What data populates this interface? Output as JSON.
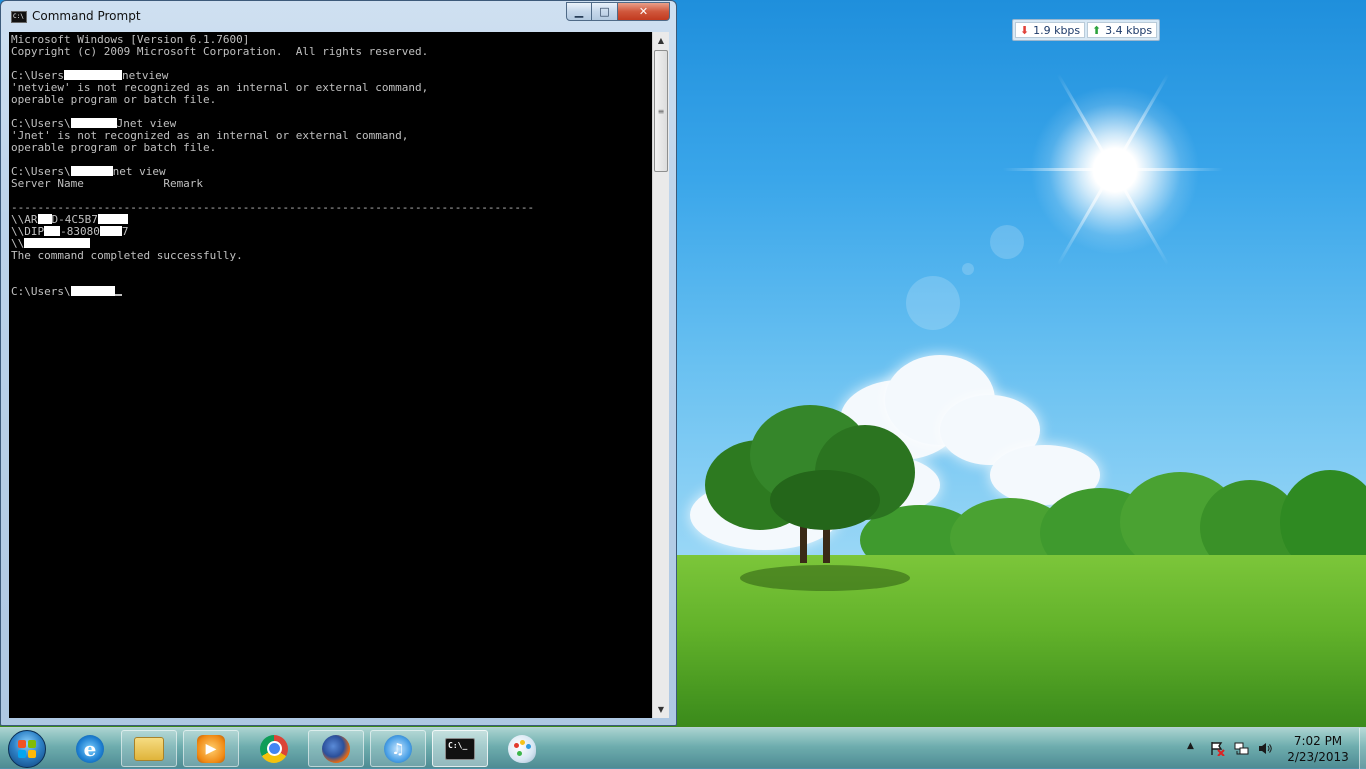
{
  "window": {
    "title": "Command Prompt",
    "icon_label": "C:\\",
    "minimize_symbol": "▁",
    "maximize_symbol": "□",
    "close_symbol": "✕"
  },
  "console": {
    "lines": [
      "Microsoft Windows [Version 6.1.7600]",
      "Copyright (c) 2009 Microsoft Corporation.  All rights reserved.",
      "",
      "C:\\Users",
      "'netview' is not recognized as an internal or external command,",
      "operable program or batch file.",
      "",
      "C:\\Users\\",
      "'Jnet' is not recognized as an internal or external command,",
      "operable program or batch file.",
      "",
      "C:\\Users\\",
      "Server Name            Remark",
      "",
      "-------------------------------------------------------------------------------",
      "\\\\AR",
      "\\\\DIP",
      "\\\\",
      "The command completed successfully.",
      "",
      "",
      "C:\\Users\\"
    ],
    "cmd_netview": "netview",
    "cmd_jnet": "Jnet view",
    "cmd_net_view": "net view",
    "server1_part": "D-4C5B7",
    "server2_part": "-83080",
    "server2_tail": "7"
  },
  "net_meter": {
    "download": "1.9 kbps",
    "upload": "3.4 kbps",
    "download_arrow": "⬇",
    "upload_arrow": "⬆"
  },
  "taskbar": {
    "apps": [
      {
        "name": "internet-explorer",
        "state": "pinned"
      },
      {
        "name": "windows-explorer",
        "state": "running"
      },
      {
        "name": "windows-media-player",
        "state": "running"
      },
      {
        "name": "google-chrome",
        "state": "pinned"
      },
      {
        "name": "firefox",
        "state": "running"
      },
      {
        "name": "itunes",
        "state": "running"
      },
      {
        "name": "command-prompt",
        "state": "active"
      },
      {
        "name": "paint",
        "state": "pinned"
      }
    ],
    "ie_glyph": "e",
    "wmp_glyph": "▶",
    "itunes_glyph": "♫",
    "cmd_glyph": "C:\\_",
    "tray_arrow": "▲",
    "time": "7:02 PM",
    "date": "2/23/2013"
  },
  "colors": {
    "console_bg": "#000000",
    "console_fg": "#c0c0c0",
    "close_button": "#c23a1f",
    "download_arrow": "#e0423a",
    "upload_arrow": "#2aa23b"
  }
}
